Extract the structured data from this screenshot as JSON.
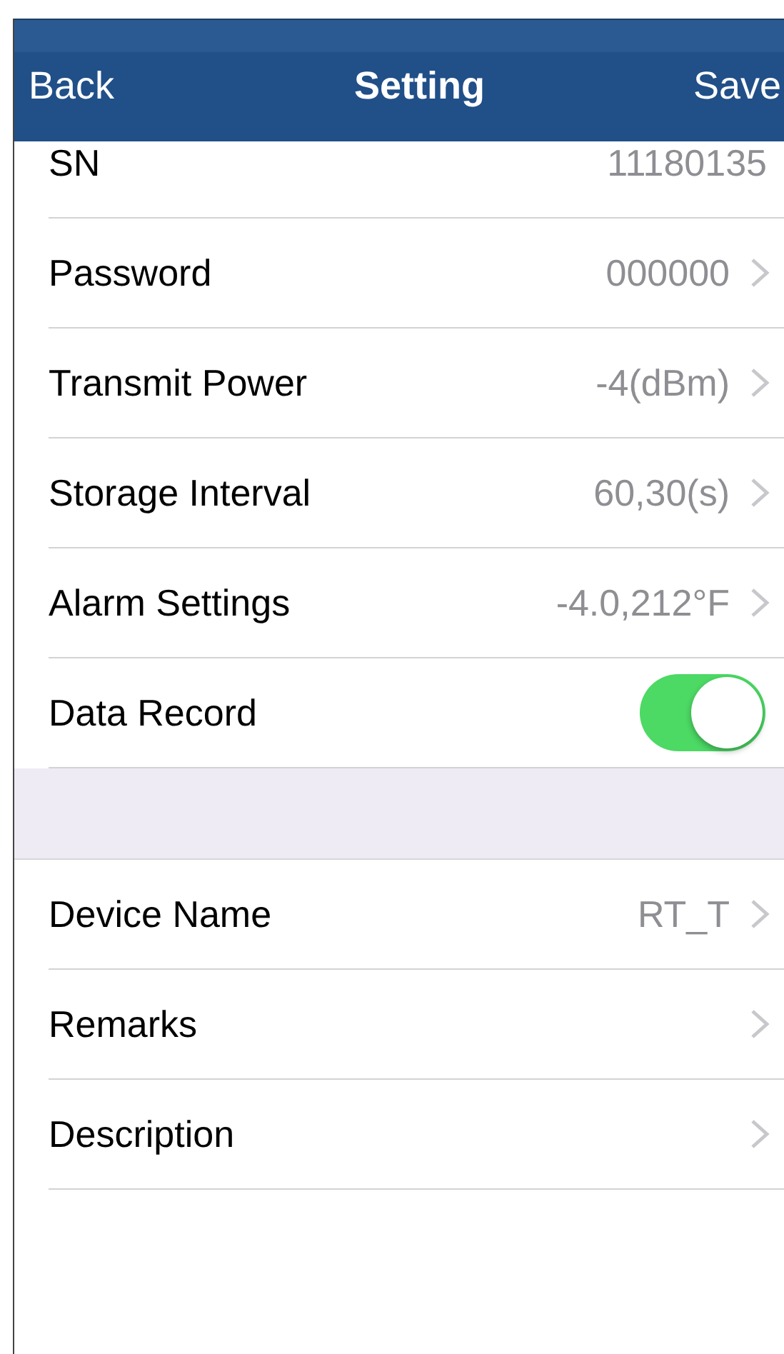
{
  "nav_bar": {
    "back": "Back",
    "title": "Setting",
    "save": "Save"
  },
  "sections": [
    {
      "rows": [
        {
          "kind": "value",
          "label": "SN",
          "value": "11180135"
        },
        {
          "kind": "link",
          "label": "Password",
          "value": "000000"
        },
        {
          "kind": "link",
          "label": "Transmit Power",
          "value": "-4(dBm)"
        },
        {
          "kind": "link",
          "label": "Storage Interval",
          "value": "60,30(s)"
        },
        {
          "kind": "link",
          "label": "Alarm Settings",
          "value": "-4.0,212°F"
        },
        {
          "kind": "toggle",
          "label": "Data Record",
          "on": true
        }
      ]
    },
    {
      "rows": [
        {
          "kind": "link",
          "label": "Device Name",
          "value": "RT_T"
        },
        {
          "kind": "link",
          "label": "Remarks"
        },
        {
          "kind": "link",
          "label": "Description"
        }
      ]
    }
  ]
}
